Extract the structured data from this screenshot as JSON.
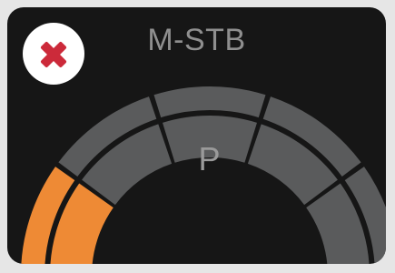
{
  "header": {
    "mode_label": "M-STB"
  },
  "close_button": {
    "icon": "close-icon",
    "icon_color": "#cc2a3a"
  },
  "gauge": {
    "gear_label": "P",
    "level": 0.2,
    "active_color": "#ee8a35",
    "inactive_color": "#5a5b5c"
  }
}
